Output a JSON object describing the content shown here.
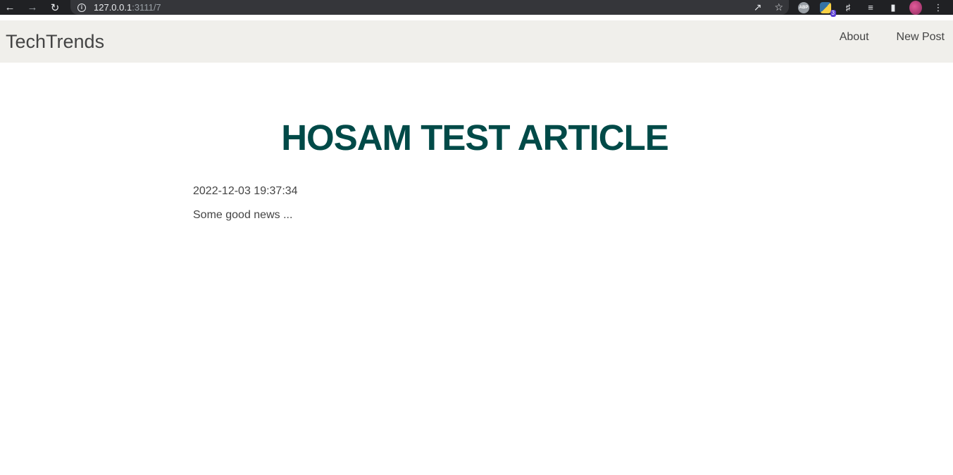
{
  "browser": {
    "url_host": "127.0.0.1",
    "url_rest": ":3111/7",
    "extensions": {
      "abp_label": "ABP",
      "python_badge": "3"
    }
  },
  "header": {
    "brand": "TechTrends",
    "nav": [
      {
        "label": "About"
      },
      {
        "label": "New Post"
      }
    ]
  },
  "article": {
    "title": "HOSAM TEST ARTICLE",
    "created": "2022-12-03 19:37:34",
    "content": "Some good news ..."
  },
  "colors": {
    "title": "#004a48",
    "header_bg": "#f0efeb",
    "text": "#444444"
  }
}
